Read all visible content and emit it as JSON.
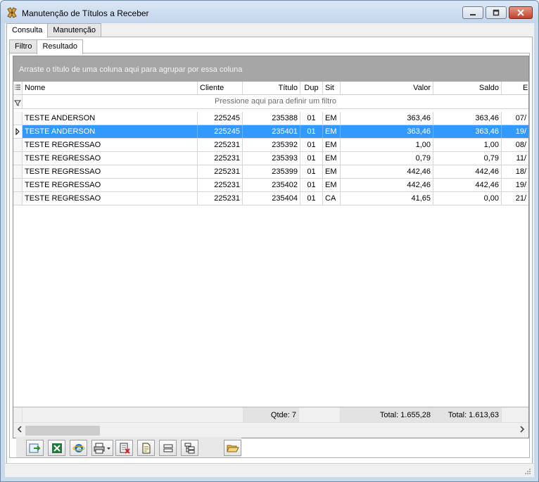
{
  "window": {
    "title": "Manutenção de Títulos a Receber"
  },
  "tabs_outer": [
    {
      "label": "Consulta"
    },
    {
      "label": "Manutenção"
    }
  ],
  "tabs_inner": [
    {
      "label": "Filtro"
    },
    {
      "label": "Resultado"
    }
  ],
  "grid": {
    "group_panel_text": "Arraste o título de uma coluna aqui para agrupar por essa coluna",
    "filter_hint": "Pressione aqui para definir um filtro",
    "columns": {
      "nome": "Nome",
      "cliente": "Cliente",
      "titulo": "Título",
      "dup": "Dup",
      "sit": "Sit",
      "valor": "Valor",
      "saldo": "Saldo",
      "em": "Em"
    },
    "rows": [
      {
        "nome": "TESTE ANDERSON",
        "cliente": "225245",
        "titulo": "235388",
        "dup": "01",
        "sit": "EM",
        "valor": "363,46",
        "saldo": "363,46",
        "em": "07/"
      },
      {
        "nome": "TESTE ANDERSON",
        "cliente": "225245",
        "titulo": "235401",
        "dup": "01",
        "sit": "EM",
        "valor": "363,46",
        "saldo": "363,46",
        "em": "19/"
      },
      {
        "nome": "TESTE REGRESSAO",
        "cliente": "225231",
        "titulo": "235392",
        "dup": "01",
        "sit": "EM",
        "valor": "1,00",
        "saldo": "1,00",
        "em": "08/"
      },
      {
        "nome": "TESTE REGRESSAO",
        "cliente": "225231",
        "titulo": "235393",
        "dup": "01",
        "sit": "EM",
        "valor": "0,79",
        "saldo": "0,79",
        "em": "11/"
      },
      {
        "nome": "TESTE REGRESSAO",
        "cliente": "225231",
        "titulo": "235399",
        "dup": "01",
        "sit": "EM",
        "valor": "442,46",
        "saldo": "442,46",
        "em": "18/"
      },
      {
        "nome": "TESTE REGRESSAO",
        "cliente": "225231",
        "titulo": "235402",
        "dup": "01",
        "sit": "EM",
        "valor": "442,46",
        "saldo": "442,46",
        "em": "19/"
      },
      {
        "nome": "TESTE REGRESSAO",
        "cliente": "225231",
        "titulo": "235404",
        "dup": "01",
        "sit": "CA",
        "valor": "41,65",
        "saldo": "0,00",
        "em": "21/"
      }
    ],
    "selected_row": 1,
    "footer": {
      "qtde": "Qtde: 7",
      "total_valor": "Total: 1.655,28",
      "total_saldo": "Total: 1.613,63"
    }
  },
  "toolbar": {
    "buttons": [
      {
        "icon": "export-arrow-icon"
      },
      {
        "icon": "excel-icon"
      },
      {
        "icon": "internet-explorer-icon"
      },
      {
        "icon": "print-icon"
      },
      {
        "icon": "delete-doc-icon"
      },
      {
        "icon": "document-icon"
      },
      {
        "icon": "collapse-icon"
      },
      {
        "icon": "tree-icon"
      },
      {
        "icon": "open-folder-icon"
      }
    ]
  },
  "colors": {
    "selection": "#3399ff",
    "group_panel": "#a6a6a6"
  }
}
